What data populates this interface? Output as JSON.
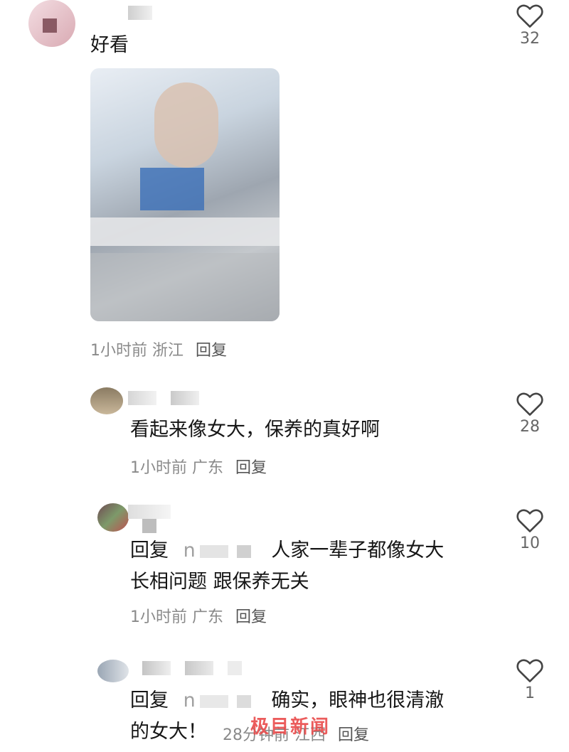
{
  "comments": [
    {
      "text": "好看",
      "meta": {
        "time": "1小时前",
        "location": "浙江",
        "reply": "回复"
      },
      "likes": "32"
    },
    {
      "text": "看起来像女大，保养的真好啊",
      "meta": {
        "time": "1小时前",
        "location": "广东",
        "reply": "回复"
      },
      "likes": "28"
    },
    {
      "reply_prefix": "回复",
      "mention": "n",
      "text": "人家一辈子都像女大",
      "text2": "长相问题 跟保养无关",
      "meta": {
        "time": "1小时前",
        "location": "广东",
        "reply": "回复"
      },
      "likes": "10"
    },
    {
      "reply_prefix": "回复",
      "mention": "n",
      "text": "确实，眼神也很清澈",
      "text2": "的女大！",
      "meta": {
        "time": "28分钟前",
        "location": "江西",
        "reply": "回复"
      },
      "likes": "1"
    }
  ],
  "watermark": "极目新闻",
  "icons": {
    "like": "heart-outline-icon"
  },
  "colors": {
    "text": "#161616",
    "meta": "#8a8a8a",
    "icon": "#444444"
  }
}
